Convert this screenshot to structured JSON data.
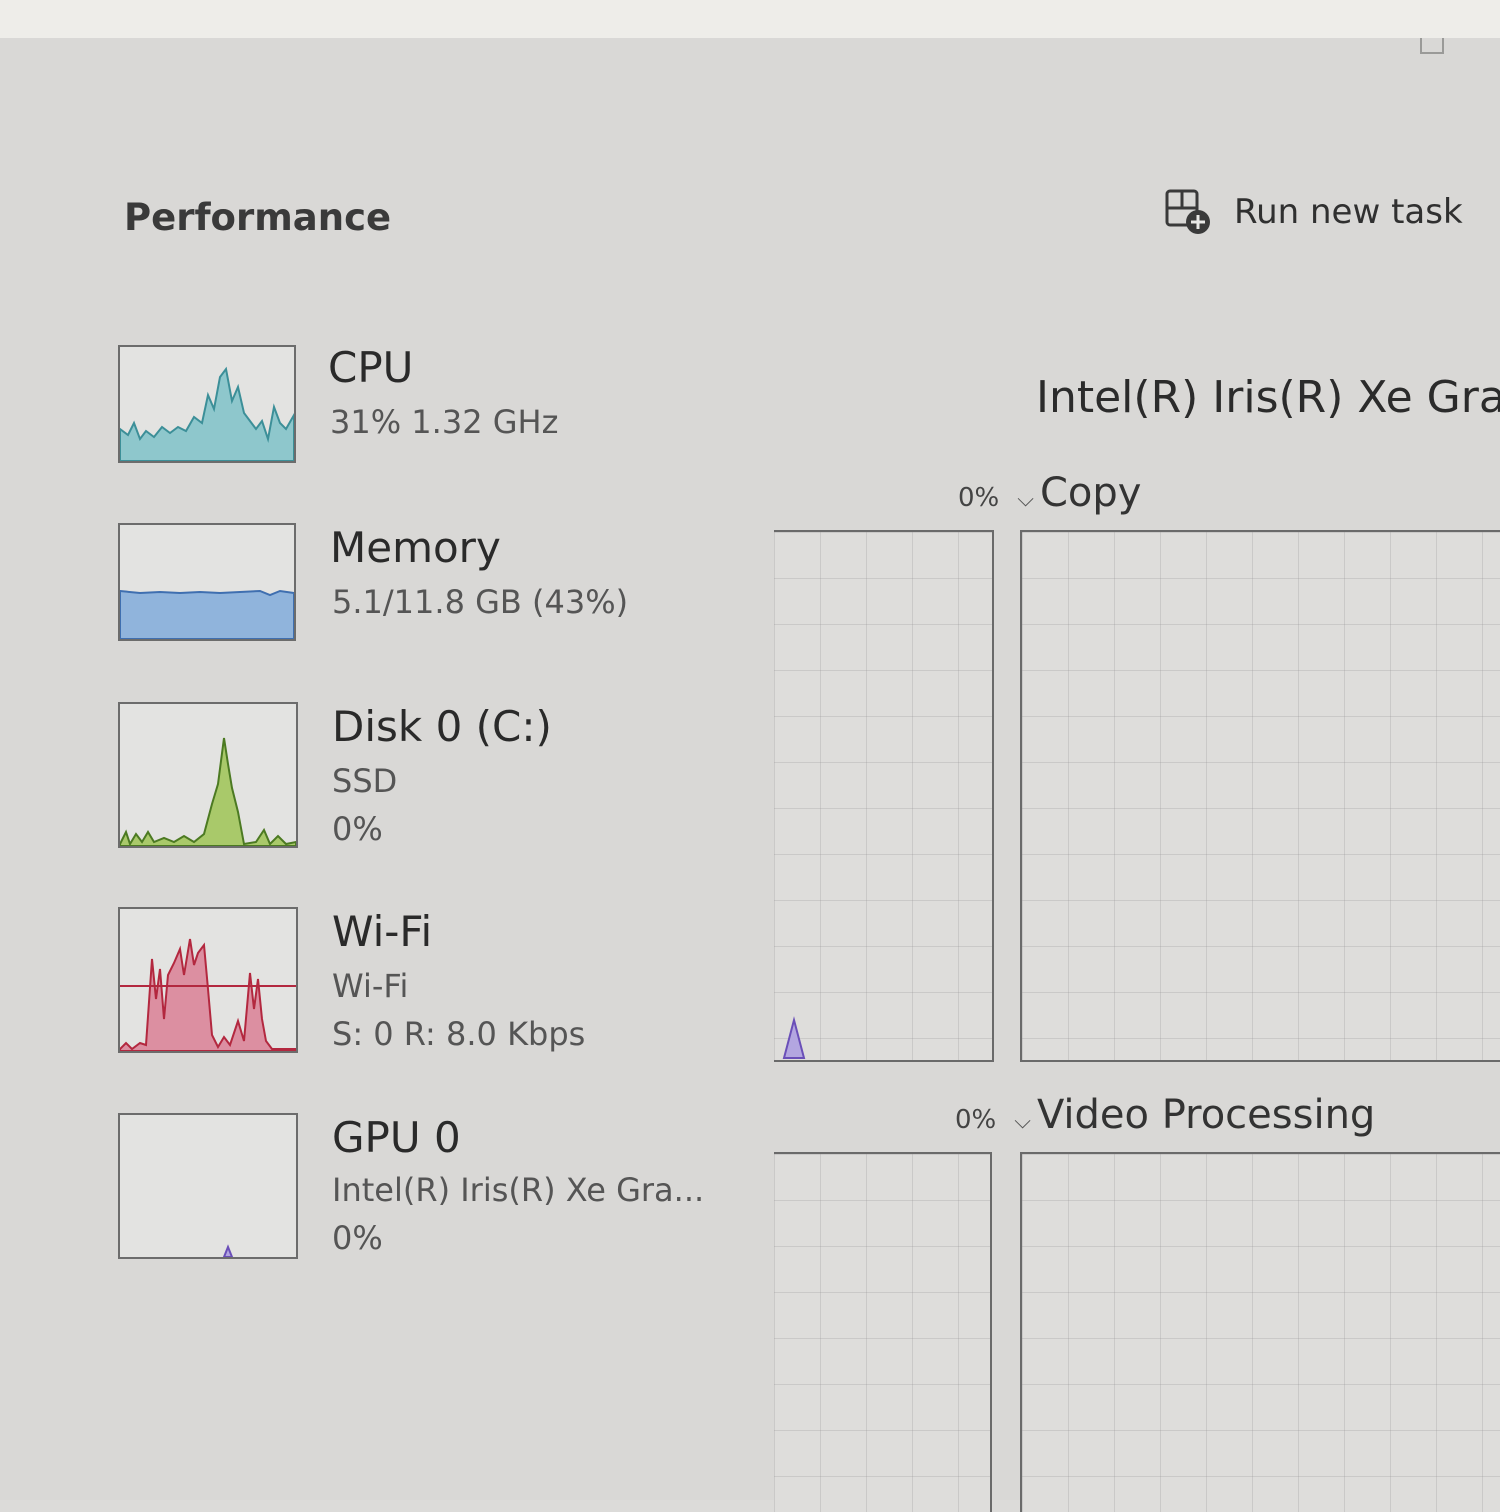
{
  "header": {
    "title": "Performance",
    "run_new_task_label": "Run new task"
  },
  "sidebar": {
    "items": [
      {
        "id": "cpu",
        "name": "CPU",
        "line1": "31%  1.32 GHz",
        "color": "#3c8f98",
        "fill": "#8ec7cc"
      },
      {
        "id": "memory",
        "name": "Memory",
        "line1": "5.1/11.8 GB (43%)",
        "color": "#3f6fb0",
        "fill": "#90b4dc"
      },
      {
        "id": "disk",
        "name": "Disk 0 (C:)",
        "line1": "SSD",
        "line2": "0%",
        "color": "#4c7a22",
        "fill": "#a9c96a"
      },
      {
        "id": "wifi",
        "name": "Wi-Fi",
        "line1": "Wi-Fi",
        "line2": "S: 0 R: 8.0 Kbps",
        "color": "#b3283f",
        "fill": "#dc8fa1"
      },
      {
        "id": "gpu",
        "name": "GPU 0",
        "line1": "Intel(R) Iris(R) Xe Gra...",
        "line2": "0%",
        "color": "#6a4fb8",
        "fill": "#b3a6e0"
      }
    ]
  },
  "detail": {
    "gpu_name": "Intel(R) Iris(R) Xe Graph",
    "engines": [
      {
        "name": "Copy",
        "percent": "0%"
      },
      {
        "name": "Video Processing",
        "percent": "0%"
      }
    ]
  },
  "icons": {
    "run_task": "run-task-icon",
    "chevron": "chevron-down-icon"
  },
  "chevron_glyph": "⌵"
}
